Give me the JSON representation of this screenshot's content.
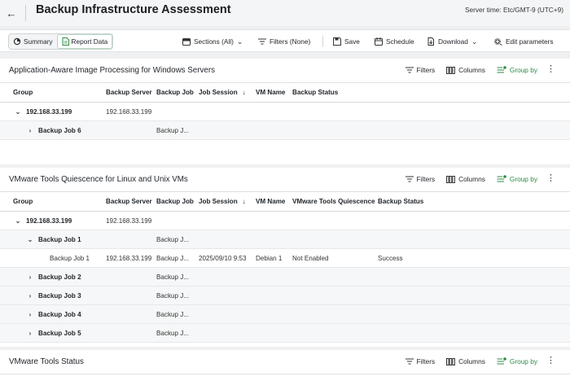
{
  "header": {
    "title": "Backup Infrastructure Assessment",
    "server_time": "Server time: Etc/GMT-9 (UTC+9)"
  },
  "toolbar": {
    "summary_label": "Summary",
    "report_data_label": "Report Data",
    "sections_label": "Sections (All)",
    "filters_label": "Filters (None)",
    "save_label": "Save",
    "schedule_label": "Schedule",
    "download_label": "Download",
    "edit_params_label": "Edit parameters"
  },
  "section_tools": {
    "filters": "Filters",
    "columns": "Columns",
    "group_by": "Group by"
  },
  "sections": [
    {
      "title": "Application-Aware Image Processing for Windows Servers",
      "columns": [
        "Group",
        "Backup Server",
        "Backup Job",
        "Job Session",
        "VM Name",
        "Backup Status"
      ],
      "rows": [
        {
          "group": "192.168.33.199",
          "server": "192.168.33.199",
          "job": "",
          "session": "",
          "vm": ""
        },
        {
          "group": "Backup Job 6",
          "server": "",
          "job": "Backup J...",
          "session": "",
          "vm": ""
        }
      ]
    },
    {
      "title": "VMware Tools Quiescence for Linux and Unix VMs",
      "columns": [
        "Group",
        "Backup Server",
        "Backup Job",
        "Job Session",
        "VM Name",
        "VMware Tools Quiescence",
        "Backup Status"
      ],
      "rows": [
        {
          "group": "192.168.33.199",
          "server": "192.168.33.199",
          "job": "",
          "session": "",
          "vm": "",
          "quiescence": "",
          "status": ""
        },
        {
          "group": "Backup Job 1",
          "server": "",
          "job": "Backup J...",
          "session": "",
          "vm": "",
          "quiescence": "",
          "status": ""
        },
        {
          "group": "Backup Job 1",
          "server": "192.168.33.199",
          "job": "Backup J...",
          "session": "2025/09/10 9:53",
          "vm": "Debian 1",
          "quiescence": "Not Enabled",
          "status": "Success"
        },
        {
          "group": "Backup Job 2",
          "server": "",
          "job": "Backup J...",
          "session": "",
          "vm": "",
          "quiescence": "",
          "status": ""
        },
        {
          "group": "Backup Job 3",
          "server": "",
          "job": "Backup J...",
          "session": "",
          "vm": "",
          "quiescence": "",
          "status": ""
        },
        {
          "group": "Backup Job 4",
          "server": "",
          "job": "Backup J...",
          "session": "",
          "vm": "",
          "quiescence": "",
          "status": ""
        },
        {
          "group": "Backup Job 5",
          "server": "",
          "job": "Backup J...",
          "session": "",
          "vm": "",
          "quiescence": "",
          "status": ""
        }
      ]
    },
    {
      "title": "VMware Tools Status"
    }
  ],
  "icons": {
    "back": "arrow-left-icon",
    "sort": "arrow-down-icon"
  },
  "colors": {
    "accent_green": "#2e8b45"
  }
}
